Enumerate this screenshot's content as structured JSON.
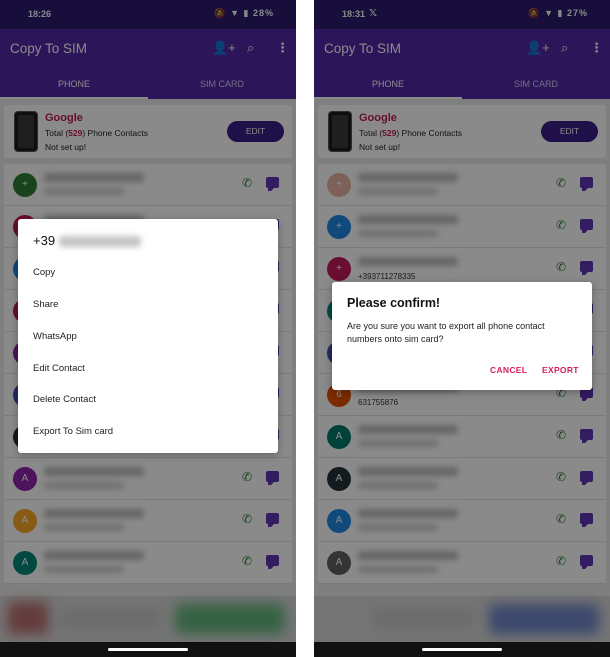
{
  "left": {
    "statusbar": {
      "time": "18:26",
      "icons": "🔕 ▼ ▮ 28%"
    },
    "appbar": {
      "title": "Copy To SIM"
    },
    "tabs": [
      "PHONE",
      "SIM CARD"
    ],
    "card": {
      "account": "Google",
      "total_prefix": "Total (",
      "total_count": "529",
      "total_suffix": ") Phone Contacts",
      "status": "Not set up!",
      "edit_label": "EDIT"
    },
    "rows": [
      {
        "avatar": "+",
        "color": "#2e7d32"
      },
      {
        "avatar": "+",
        "color": "#c2185b"
      },
      {
        "avatar": "+",
        "color": "#1e88e5"
      },
      {
        "avatar": "+",
        "color": "#c2185b"
      },
      {
        "avatar": "+",
        "color": "#8e24aa"
      },
      {
        "avatar": "6",
        "color": "#3f51b5"
      },
      {
        "avatar": "A",
        "color": "#263238"
      },
      {
        "avatar": "A",
        "color": "#8e24aa"
      },
      {
        "avatar": "A",
        "color": "#f9a825"
      },
      {
        "avatar": "A",
        "color": "#00897b"
      }
    ],
    "menu": {
      "title_prefix": "+39",
      "items": [
        "Copy",
        "Share",
        "WhatsApp",
        "Edit Contact",
        "Delete Contact",
        "Export To Sim card"
      ]
    }
  },
  "right": {
    "statusbar": {
      "time": "18:31",
      "x_icon": "𝕏",
      "icons": "🔕 ▼ ▮ 27%"
    },
    "appbar": {
      "title": "Copy To SIM"
    },
    "tabs": [
      "PHONE",
      "SIM CARD"
    ],
    "card": {
      "account": "Google",
      "total_prefix": "Total (",
      "total_count": "529",
      "total_suffix": ") Phone Contacts",
      "status": "Not set up!",
      "edit_label": "EDIT"
    },
    "rows": [
      {
        "avatar": "+",
        "color": "#e8b4a4"
      },
      {
        "avatar": "+",
        "color": "#1e88e5"
      },
      {
        "avatar": "+",
        "color": "#c2185b",
        "plain": "+393711278335"
      },
      {
        "avatar": "+",
        "color": "#00897b"
      },
      {
        "avatar": "+",
        "color": "#3f51b5"
      },
      {
        "avatar": "6",
        "color": "#e65100",
        "plain": "631755876"
      },
      {
        "avatar": "A",
        "color": "#00796b"
      },
      {
        "avatar": "A",
        "color": "#263238"
      },
      {
        "avatar": "A",
        "color": "#1e88e5"
      },
      {
        "avatar": "A",
        "color": "#616161"
      }
    ],
    "dialog": {
      "title": "Please confirm!",
      "message": "Are you sure you want to export all phone contact numbers onto sim card?",
      "cancel": "CANCEL",
      "export": "EXPORT"
    }
  },
  "icons": {
    "add_person": "👤+",
    "search": "⌕",
    "more": "⋮",
    "call": "✆"
  }
}
